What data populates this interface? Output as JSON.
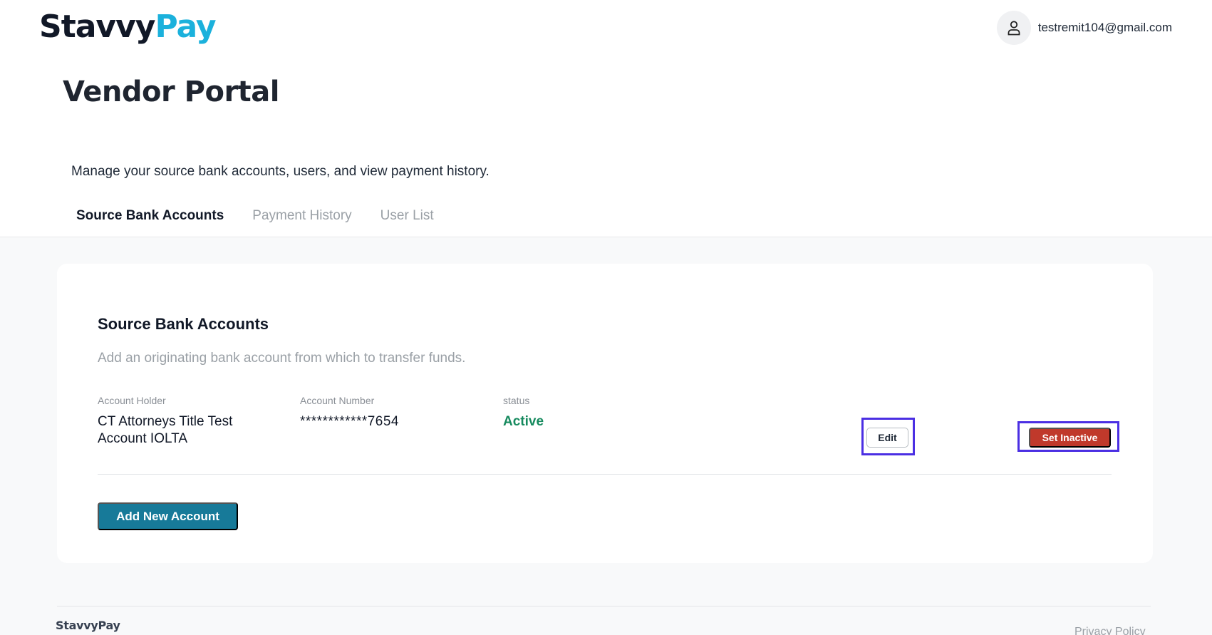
{
  "header": {
    "logo_part1": "Stavvy",
    "logo_part2": "Pay",
    "user_email": "testremit104@gmail.com"
  },
  "page": {
    "title": "Vendor Portal",
    "description": "Manage your source bank accounts, users, and view payment history."
  },
  "tabs": [
    {
      "label": "Source Bank Accounts",
      "active": true
    },
    {
      "label": "Payment History",
      "active": false
    },
    {
      "label": "User List",
      "active": false
    }
  ],
  "card": {
    "title": "Source Bank Accounts",
    "subtitle": "Add an originating bank account from which to transfer funds.",
    "columns": {
      "holder_label": "Account Holder",
      "number_label": "Account Number",
      "status_label": "status"
    },
    "account": {
      "holder_line1": "CT Attorneys Title Test",
      "holder_line2": "Account IOLTA",
      "number": "************7654",
      "status": "Active"
    },
    "edit_label": "Edit",
    "set_inactive_label": "Set Inactive",
    "add_label": "Add New Account"
  },
  "footer": {
    "logo": "StavvyPay",
    "privacy_link": "Privacy Policy"
  },
  "colors": {
    "brand_blue": "#1bb1dc",
    "primary_button": "#177a99",
    "danger_button": "#c0392b",
    "status_active": "#168a5e",
    "highlight": "#4b2fe3"
  }
}
